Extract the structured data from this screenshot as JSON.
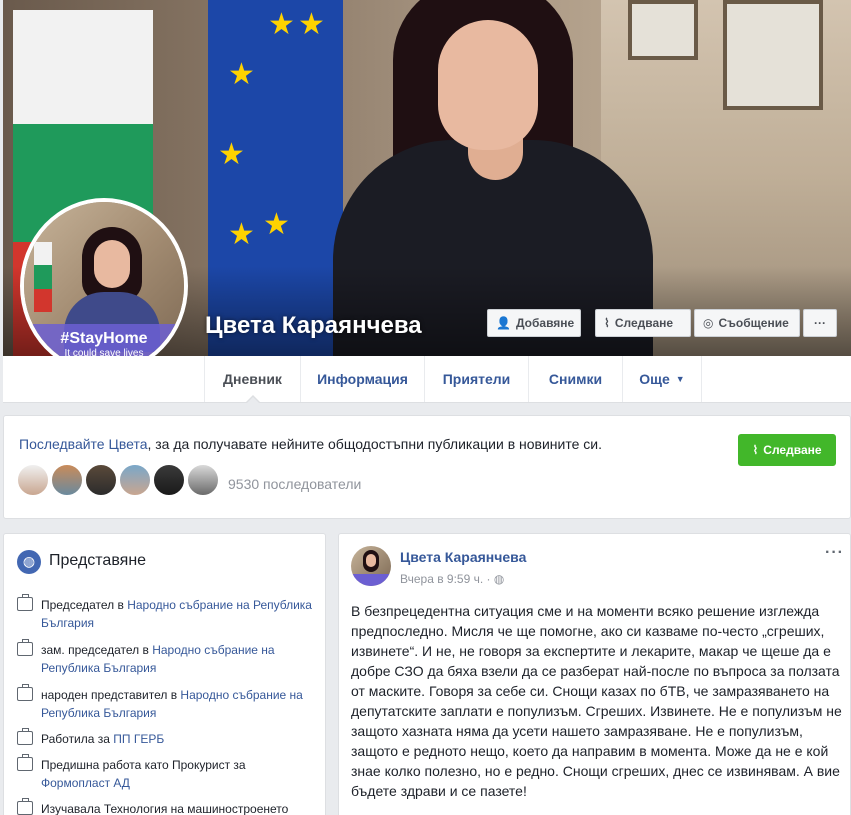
{
  "page": {
    "name": "Цвета Караянчева",
    "profile_banner_tag": "#StayHome",
    "profile_banner_sub": "It could save lives"
  },
  "cover_buttons": {
    "add": "Добавяне",
    "follow": "Следване",
    "message": "Съобщение",
    "more": "···"
  },
  "tabs": [
    {
      "label": "Дневник"
    },
    {
      "label": "Информация"
    },
    {
      "label": "Приятели"
    },
    {
      "label": "Снимки"
    },
    {
      "label": "Още"
    }
  ],
  "follow_banner": {
    "link": "Последвайте Цвета",
    "text": ", за да получавате нейните общодостъпни публикации в новините си.",
    "button": "Следване",
    "followers": "9530 последователи"
  },
  "intro": {
    "title": "Представяне",
    "items": [
      {
        "prefix": "Председател в ",
        "link": "Народно събрание на Република България"
      },
      {
        "prefix": "зам. председател в ",
        "link": "Народно събрание на Република България"
      },
      {
        "prefix": "народен представител в ",
        "link": "Народно събрание на Република България"
      },
      {
        "prefix": "Работила за ",
        "link": "ПП ГЕРБ"
      },
      {
        "prefix": "Предишна работа като Прокурист за ",
        "link": "Формопласт АД"
      },
      {
        "prefix": "Изучавала Технология на машиностроенето",
        "link": ""
      }
    ]
  },
  "post": {
    "author": "Цвета Караянчева",
    "time": "Вчера в 9:59 ч. · ",
    "menu": "···",
    "body": "В безпрецедентна ситуация сме и на моменти всяко решение изглежда предпоследно. Мисля че ще помогне, ако си казваме по-често „сгреших, извинете“. И не, не говоря за експертите и лекарите, макар че щеше да е добре СЗО да бяха взели да се разберат най-после по въпроса за ползата от маските. Говоря за себе си. Снощи казах по бТВ, че замразяването на депутатските заплати е популизъм. Сгреших. Извинете. Не е популизъм не защото хазната няма да усети нашето замразяване. Не е популизъм, защото е редното нещо, което да направим в момента. Може да не е кой знае колко полезно, но е редно. Снощи сгреших, днес се извинявам. А вие бъдете здрави и се пазете!"
  },
  "colors": {
    "link": "#365899",
    "follow_green": "#42b72a",
    "page_bg": "#e9ebee"
  }
}
